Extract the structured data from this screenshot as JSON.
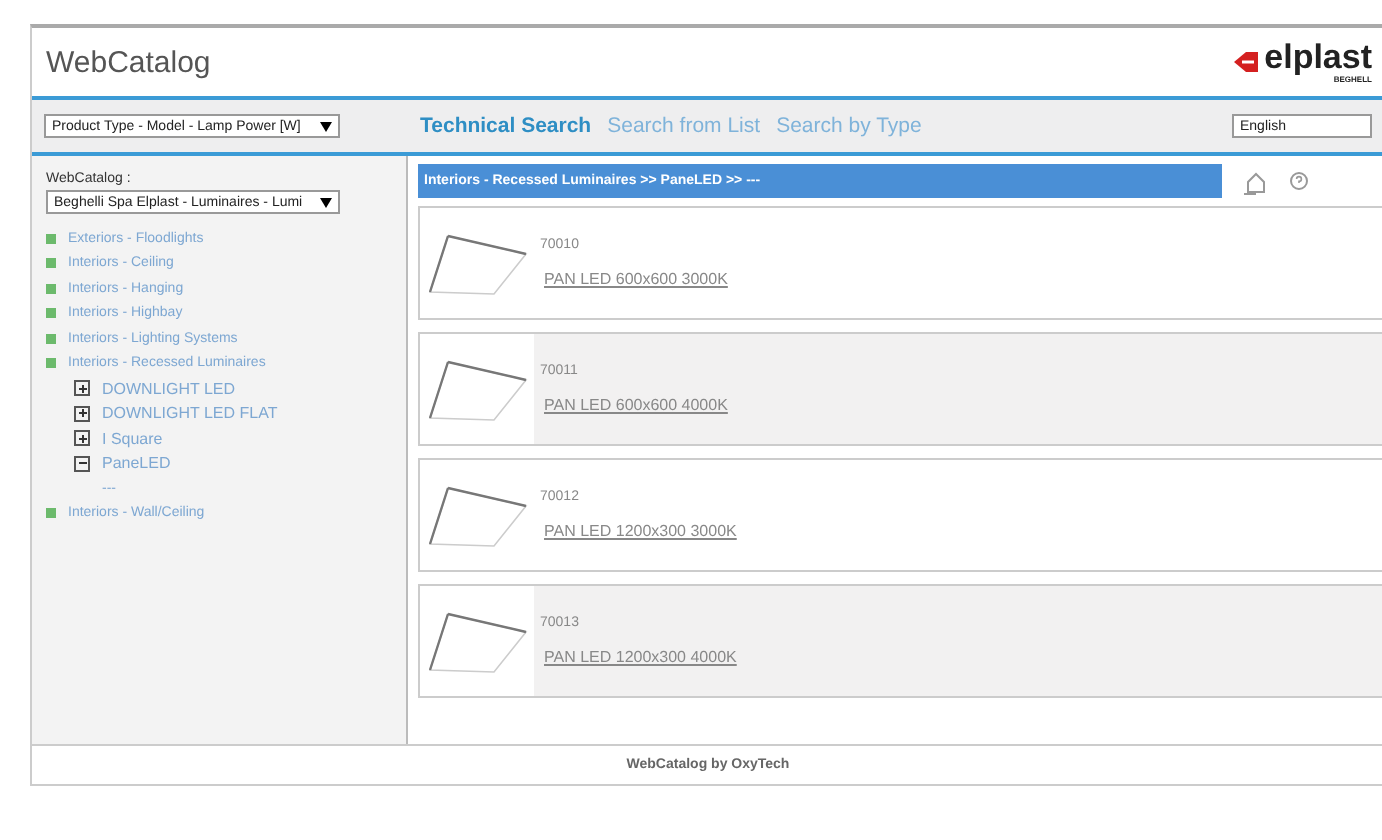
{
  "header": {
    "title": "WebCatalog",
    "logo_text": "elplast",
    "logo_subtext": "BEGHELL"
  },
  "toolbar": {
    "search_mode_select": "Product Type - Model - Lamp Power [W]",
    "tabs": [
      {
        "label": "Technical Search",
        "selected": true
      },
      {
        "label": "Search from List",
        "selected": false
      },
      {
        "label": "Search by Type",
        "selected": false
      }
    ],
    "language_select": "English"
  },
  "sidebar": {
    "catalog_label": "WebCatalog :",
    "catalog_select": "Beghelli Spa Elplast - Luminaires - Lumi",
    "tree": [
      {
        "label": "Exteriors - Floodlights"
      },
      {
        "label": "Interiors - Ceiling"
      },
      {
        "label": "Interiors - Hanging"
      },
      {
        "label": "Interiors - Highbay"
      },
      {
        "label": "Interiors - Lighting Systems"
      },
      {
        "label": "Interiors - Recessed Luminaires",
        "children": [
          {
            "label": "DOWNLIGHT LED",
            "expanded": false
          },
          {
            "label": "DOWNLIGHT LED FLAT",
            "expanded": false
          },
          {
            "label": "I Square",
            "expanded": false
          },
          {
            "label": "PaneLED",
            "expanded": true,
            "children": [
              {
                "label": "---"
              }
            ]
          }
        ]
      },
      {
        "label": "Interiors - Wall/Ceiling"
      }
    ]
  },
  "breadcrumb": "Interiors - Recessed Luminaires >> PaneLED >> ---",
  "products": [
    {
      "code": "70010",
      "name": "PAN LED 600x600 3000K"
    },
    {
      "code": "70011",
      "name": "PAN LED 600x600 4000K"
    },
    {
      "code": "70012",
      "name": "PAN LED 1200x300 3000K"
    },
    {
      "code": "70013",
      "name": "PAN LED 1200x300 4000K"
    }
  ],
  "footer": "WebCatalog by OxyTech"
}
